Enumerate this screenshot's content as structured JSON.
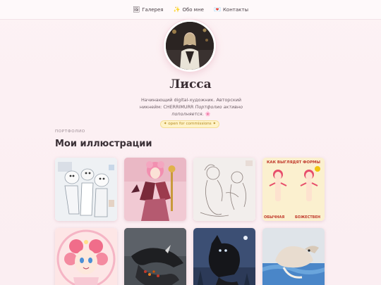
{
  "nav": {
    "items": [
      {
        "icon": "framed-picture-icon",
        "glyph": "🖼",
        "label": "Галерея"
      },
      {
        "icon": "sparkles-icon",
        "glyph": "✨",
        "label": "Обо мне"
      },
      {
        "icon": "heart-letter-icon",
        "glyph": "💌",
        "label": "Контакты"
      }
    ]
  },
  "profile": {
    "name": "Лисса",
    "bio_plain": "Начинающий digital-художник. Авторский никнейм: CHERRIMURR ",
    "bio_italic": "Портфолио активно пополняется.",
    "bio_emoji": " 🌸",
    "badge": "✦ open for commissions ✦"
  },
  "portfolio": {
    "eyebrow": "ПОРТФОЛИО",
    "title": "Мои иллюстрации",
    "artworks": [
      {
        "name": "artwork-1",
        "sign_top": "",
        "sign_bottom": ""
      },
      {
        "name": "artwork-2",
        "sign_top": "",
        "sign_bottom": ""
      },
      {
        "name": "artwork-3",
        "sign_top": "",
        "sign_bottom": ""
      },
      {
        "name": "artwork-4",
        "sign_top": "КАК ВЫГЛЯДЯТ ФОРМЫ",
        "sign_bottom_left": "ОБЫЧНАЯ",
        "sign_bottom_right": "БОЖЕСТВЕН"
      },
      {
        "name": "artwork-5",
        "sign_top": "",
        "sign_bottom": ""
      },
      {
        "name": "artwork-6",
        "sign_top": "",
        "sign_bottom": ""
      },
      {
        "name": "artwork-7",
        "sign_top": "",
        "sign_bottom": ""
      },
      {
        "name": "artwork-8",
        "sign_top": "",
        "sign_bottom": ""
      }
    ]
  },
  "colors": {
    "accent_pink": "#f3c4d1",
    "badge_bg": "#fff3c9",
    "badge_text": "#b4881a"
  }
}
